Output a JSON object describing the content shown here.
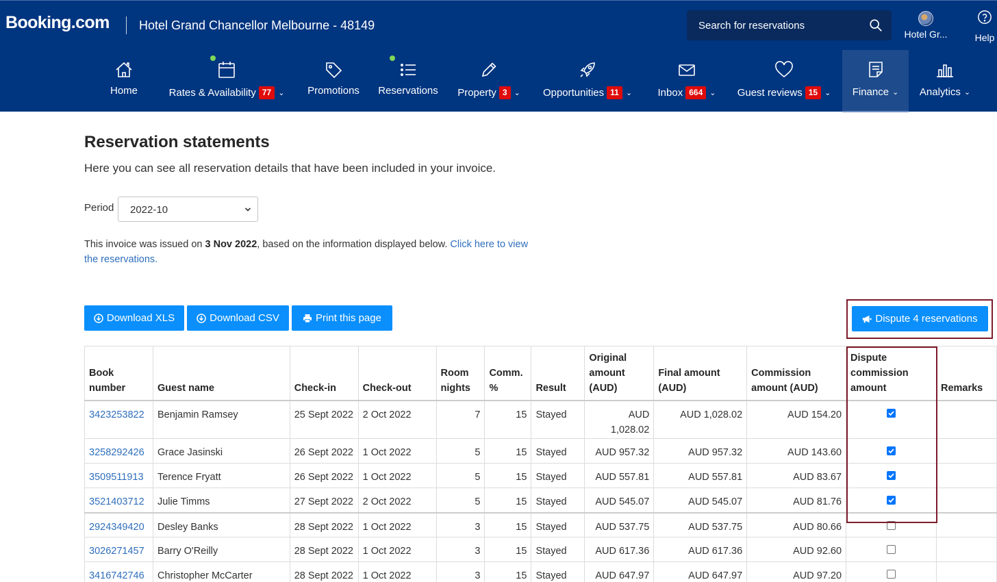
{
  "header": {
    "logo": "Booking.com",
    "hotel": "Hotel Grand Chancellor Melbourne - 48149",
    "search_placeholder": "Search for reservations",
    "account_label": "Hotel Gr...",
    "help_label": "Help"
  },
  "nav": [
    {
      "label": "Home",
      "icon": "home-icon"
    },
    {
      "label": "Rates & Availability",
      "badge": "77",
      "icon": "calendar-icon"
    },
    {
      "label": "Promotions",
      "icon": "tag-icon"
    },
    {
      "label": "Reservations",
      "icon": "list-icon"
    },
    {
      "label": "Property",
      "badge": "3",
      "icon": "pencil-icon"
    },
    {
      "label": "Opportunities",
      "badge": "11",
      "icon": "rocket-icon"
    },
    {
      "label": "Inbox",
      "badge": "664",
      "icon": "envelope-icon"
    },
    {
      "label": "Guest reviews",
      "badge": "15",
      "icon": "heart-icon"
    },
    {
      "label": "Finance",
      "icon": "document-icon",
      "active": true
    },
    {
      "label": "Analytics",
      "icon": "bar-chart-icon"
    }
  ],
  "page": {
    "title": "Reservation statements",
    "description": "Here you can see all reservation details that have been included in your invoice.",
    "period_label": "Period",
    "period_value": "2022-10",
    "invoice_prefix": "This invoice was issued on ",
    "invoice_date": "3 Nov 2022",
    "invoice_suffix": ", based on the information displayed below. ",
    "invoice_link": "Click here to view the reservations."
  },
  "buttons": {
    "download_xls": "Download XLS",
    "download_csv": "Download CSV",
    "print": "Print this page",
    "dispute": "Dispute 4 reservations"
  },
  "table": {
    "headers": {
      "book_number": "Book number",
      "guest_name": "Guest name",
      "check_in": "Check-in",
      "check_out": "Check-out",
      "room_nights": "Room nights",
      "comm": "Comm. %",
      "result": "Result",
      "original": "Original amount (AUD)",
      "final": "Final amount (AUD)",
      "commission": "Commission amount (AUD)",
      "dispute": "Dispute commission amount",
      "remarks": "Remarks"
    },
    "rows": [
      {
        "book": "3423253822",
        "guest": "Benjamin Ramsey",
        "in": "25 Sept 2022",
        "out": "2 Oct 2022",
        "nights": "7",
        "comm": "15",
        "result": "Stayed",
        "original": "AUD 1,028.02",
        "final": "AUD 1,028.02",
        "commission": "AUD 154.20",
        "dispute": true
      },
      {
        "book": "3258292426",
        "guest": "Grace Jasinski",
        "in": "26 Sept 2022",
        "out": "1 Oct 2022",
        "nights": "5",
        "comm": "15",
        "result": "Stayed",
        "original": "AUD 957.32",
        "final": "AUD 957.32",
        "commission": "AUD 143.60",
        "dispute": true
      },
      {
        "book": "3509511913",
        "guest": "Terence Fryatt",
        "in": "26 Sept 2022",
        "out": "1 Oct 2022",
        "nights": "5",
        "comm": "15",
        "result": "Stayed",
        "original": "AUD 557.81",
        "final": "AUD 557.81",
        "commission": "AUD 83.67",
        "dispute": true
      },
      {
        "book": "3521403712",
        "guest": "Julie Timms",
        "in": "27 Sept 2022",
        "out": "2 Oct 2022",
        "nights": "5",
        "comm": "15",
        "result": "Stayed",
        "original": "AUD 545.07",
        "final": "AUD 545.07",
        "commission": "AUD 81.76",
        "dispute": true
      },
      {
        "book": "2924349420",
        "guest": "Desley Banks",
        "in": "28 Sept 2022",
        "out": "1 Oct 2022",
        "nights": "3",
        "comm": "15",
        "result": "Stayed",
        "original": "AUD 537.75",
        "final": "AUD 537.75",
        "commission": "AUD 80.66",
        "dispute": false
      },
      {
        "book": "3026271457",
        "guest": "Barry O'Reilly",
        "in": "28 Sept 2022",
        "out": "1 Oct 2022",
        "nights": "3",
        "comm": "15",
        "result": "Stayed",
        "original": "AUD 617.36",
        "final": "AUD 617.36",
        "commission": "AUD 92.60",
        "dispute": false
      },
      {
        "book": "3416742746",
        "guest": "Christopher McCarter",
        "in": "28 Sept 2022",
        "out": "1 Oct 2022",
        "nights": "3",
        "comm": "15",
        "result": "Stayed",
        "original": "AUD 647.97",
        "final": "AUD 647.97",
        "commission": "AUD 97.20",
        "dispute": false
      }
    ]
  }
}
